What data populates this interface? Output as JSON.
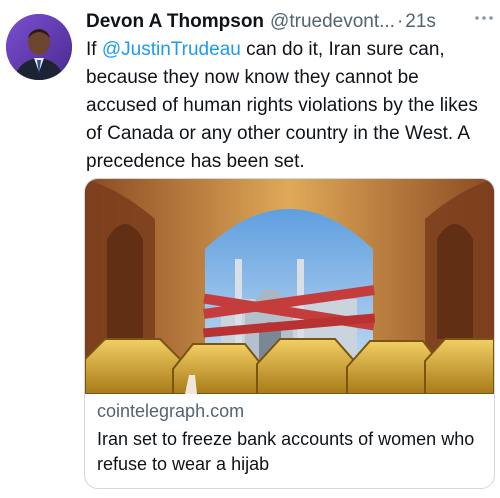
{
  "tweet": {
    "author_name": "Devon A Thompson",
    "handle": "@truedevont...",
    "separator": "·",
    "time": "21s",
    "more_icon": "ellipsis-icon",
    "text_before_mention": "If ",
    "mention": "@JustinTrudeau",
    "text_after_mention": " can do it, Iran sure can, because they now know they cannot be accused of human rights violations by the likes of Canada or any other country in the West. A precedence has been set."
  },
  "card": {
    "domain": "cointelegraph.com",
    "title": "Iran set to freeze bank accounts of women who refuse to wear a hijab"
  },
  "colors": {
    "link": "#1d9bf0",
    "secondary_text": "#536471",
    "primary_text": "#0f1419",
    "card_border": "#cfd9de"
  }
}
